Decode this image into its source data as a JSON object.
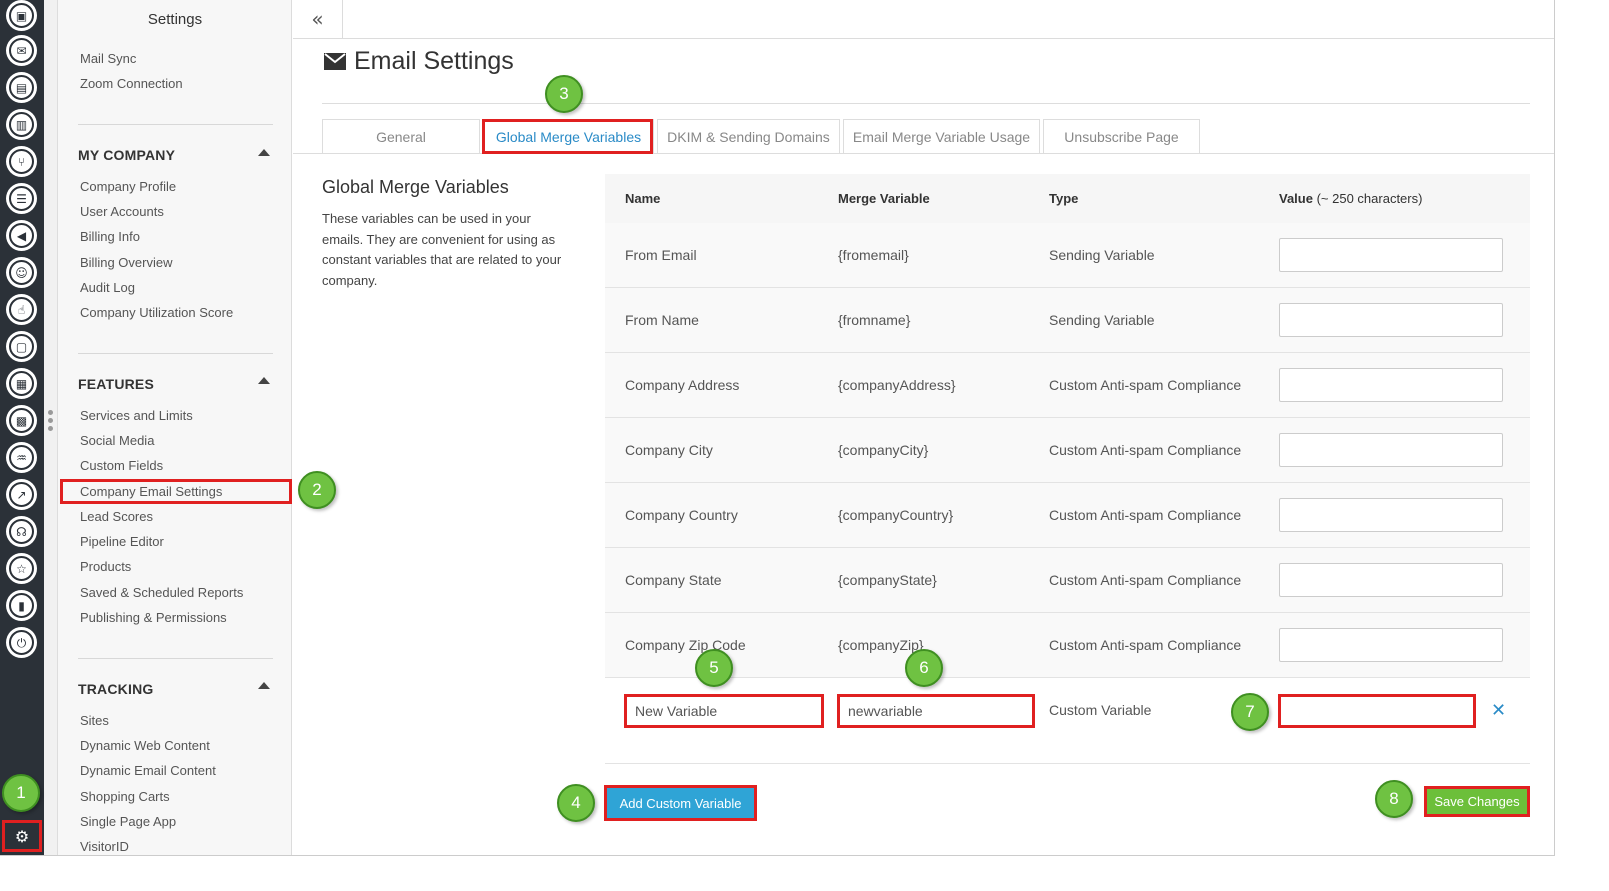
{
  "sidebar": {
    "title": "Settings",
    "top_links": [
      "Mail Sync",
      "Zoom Connection"
    ],
    "my_company": {
      "heading": "MY COMPANY",
      "items": [
        "Company Profile",
        "User Accounts",
        "Billing Info",
        "Billing Overview",
        "Audit Log",
        "Company Utilization Score"
      ]
    },
    "features": {
      "heading": "FEATURES",
      "items": [
        "Services and Limits",
        "Social Media",
        "Custom Fields",
        "Company Email Settings",
        "Lead Scores",
        "Pipeline Editor",
        "Products",
        "Saved & Scheduled Reports",
        "Publishing & Permissions"
      ]
    },
    "tracking": {
      "heading": "TRACKING",
      "items": [
        "Sites",
        "Dynamic Web Content",
        "Dynamic Email Content",
        "Shopping Carts",
        "Single Page App",
        "VisitorID"
      ]
    }
  },
  "rail_icons": [
    "contacts-icon",
    "inbox-icon",
    "clipboard-icon",
    "map-icon",
    "branch-icon",
    "list-icon",
    "megaphone-icon",
    "chat-icon",
    "thumbs-up-icon",
    "video-icon",
    "image-icon",
    "calendar-icon",
    "handshake-icon",
    "chart-icon",
    "headset-icon",
    "user-star-icon",
    "bar-chart-icon",
    "plug-icon",
    "gear-icon"
  ],
  "header": {
    "collapse_glyph": "«",
    "title": "Email Settings",
    "title_icon": "envelope-icon"
  },
  "tabs": [
    "General",
    "Global Merge Variables",
    "DKIM & Sending Domains",
    "Email Merge Variable Usage",
    "Unsubscribe Page"
  ],
  "active_tab": "Global Merge Variables",
  "section": {
    "title": "Global Merge Variables",
    "description": "These variables can be used in your emails. They are convenient for using as constant variables that are related to your company."
  },
  "table": {
    "headers": {
      "name": "Name",
      "merge": "Merge Variable",
      "type": "Type",
      "value": "Value",
      "value_note": "(~ 250 characters)"
    },
    "rows": [
      {
        "name": "From Email",
        "merge": "{fromemail}",
        "type": "Sending Variable",
        "value": ""
      },
      {
        "name": "From Name",
        "merge": "{fromname}",
        "type": "Sending Variable",
        "value": ""
      },
      {
        "name": "Company Address",
        "merge": "{companyAddress}",
        "type": "Custom Anti-spam Compliance",
        "value": ""
      },
      {
        "name": "Company City",
        "merge": "{companyCity}",
        "type": "Custom Anti-spam Compliance",
        "value": ""
      },
      {
        "name": "Company Country",
        "merge": "{companyCountry}",
        "type": "Custom Anti-spam Compliance",
        "value": ""
      },
      {
        "name": "Company State",
        "merge": "{companyState}",
        "type": "Custom Anti-spam Compliance",
        "value": ""
      },
      {
        "name": "Company Zip Code",
        "merge": "{companyZip}",
        "type": "Custom Anti-spam Compliance",
        "value": ""
      }
    ],
    "custom_row": {
      "name": "New Variable",
      "merge": "newvariable",
      "type": "Custom Variable",
      "value": "",
      "remove_glyph": "✕"
    }
  },
  "buttons": {
    "add": "Add Custom Variable",
    "save": "Save Changes"
  },
  "steps": [
    "1",
    "2",
    "3",
    "4",
    "5",
    "6",
    "7",
    "8"
  ],
  "colors": {
    "rail": "#2b3138",
    "highlight": "#e02020",
    "step": "#6fc242",
    "add_button": "#2fa4d6",
    "save_button": "#6cbf3a",
    "link": "#2a8bc7"
  }
}
